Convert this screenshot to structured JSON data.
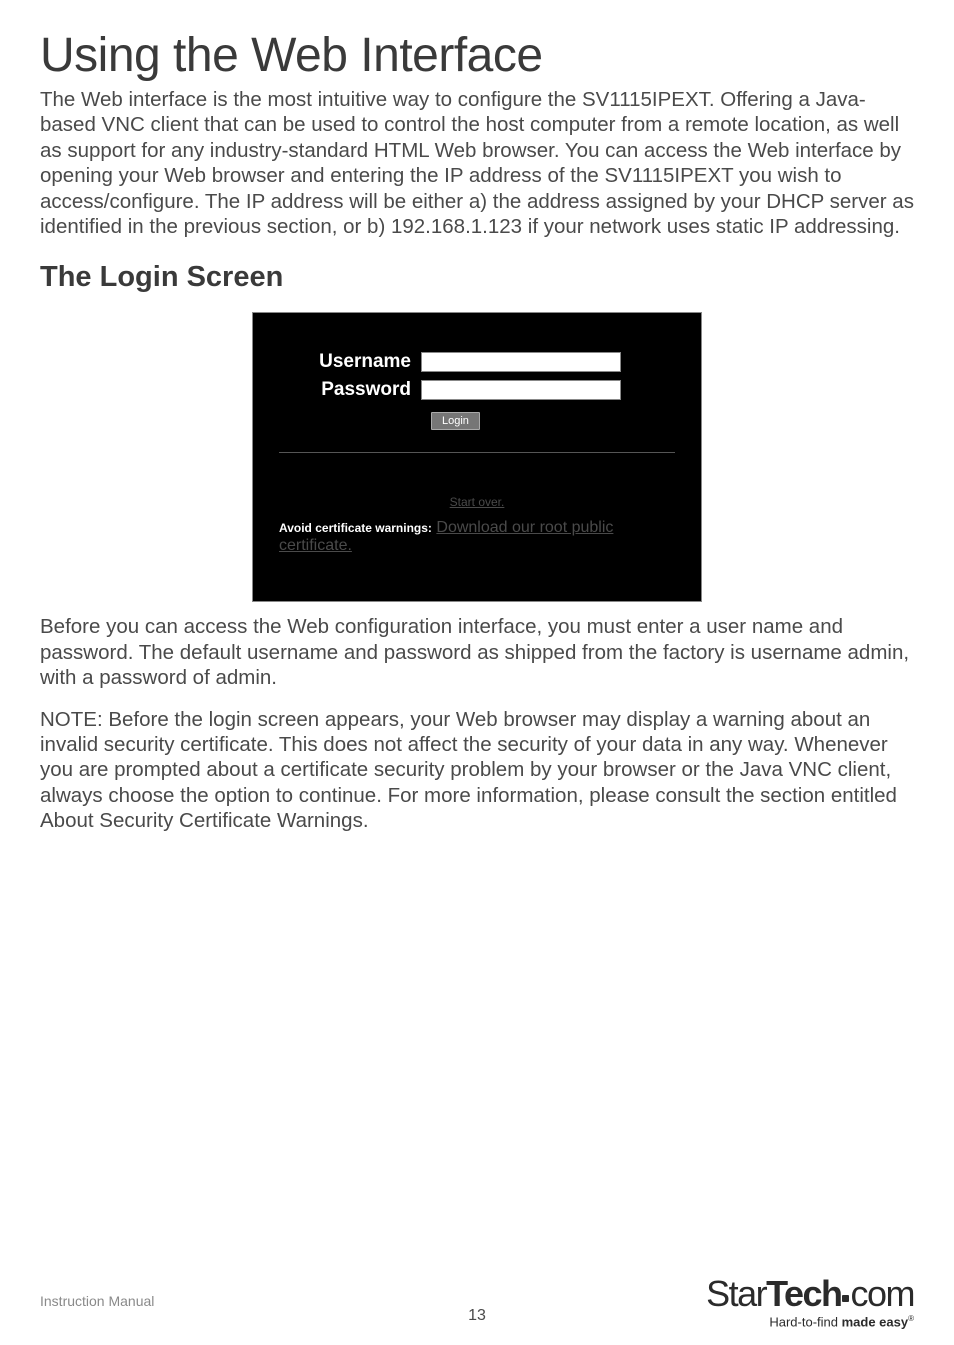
{
  "heading": "Using the Web Interface",
  "intro": "The Web interface is the most intuitive way to configure the SV1115IPEXT. Offering a Java-based VNC client that can be used to control the host computer from a remote location, as well as support for any industry-standard HTML Web browser. You can access the Web interface by opening your Web browser and entering the IP address of the SV1115IPEXT you wish to access/configure. The IP address will be either a) the address assigned by your DHCP server as identified in the previous section, or b) 192.168.1.123 if your network uses static IP addressing.",
  "subheading": "The Login Screen",
  "login": {
    "username_label": "Username",
    "password_label": "Password",
    "login_button": "Login",
    "start_over": "Start over.",
    "avoid_label": "Avoid certificate warnings:",
    "avoid_link": "Download our root public certificate."
  },
  "para2": "Before you can access the Web configuration interface, you must enter a user name and password. The default username and password as shipped from the factory is username admin, with a password of admin.",
  "para3": "NOTE: Before the login screen appears, your Web browser may display a warning about an invalid security certificate. This does not affect the security of your data in any way. Whenever you are prompted about a certificate security problem by your browser or the Java VNC client, always choose the option to continue. For more information, please consult the section entitled About Security Certificate Warnings.",
  "footer": {
    "label": "Instruction Manual",
    "page": "13",
    "logo_a": "Star",
    "logo_b": "Tech",
    "logo_c": "com",
    "tag_a": "Hard-to-find ",
    "tag_b": "made easy",
    "tag_c": "®"
  }
}
